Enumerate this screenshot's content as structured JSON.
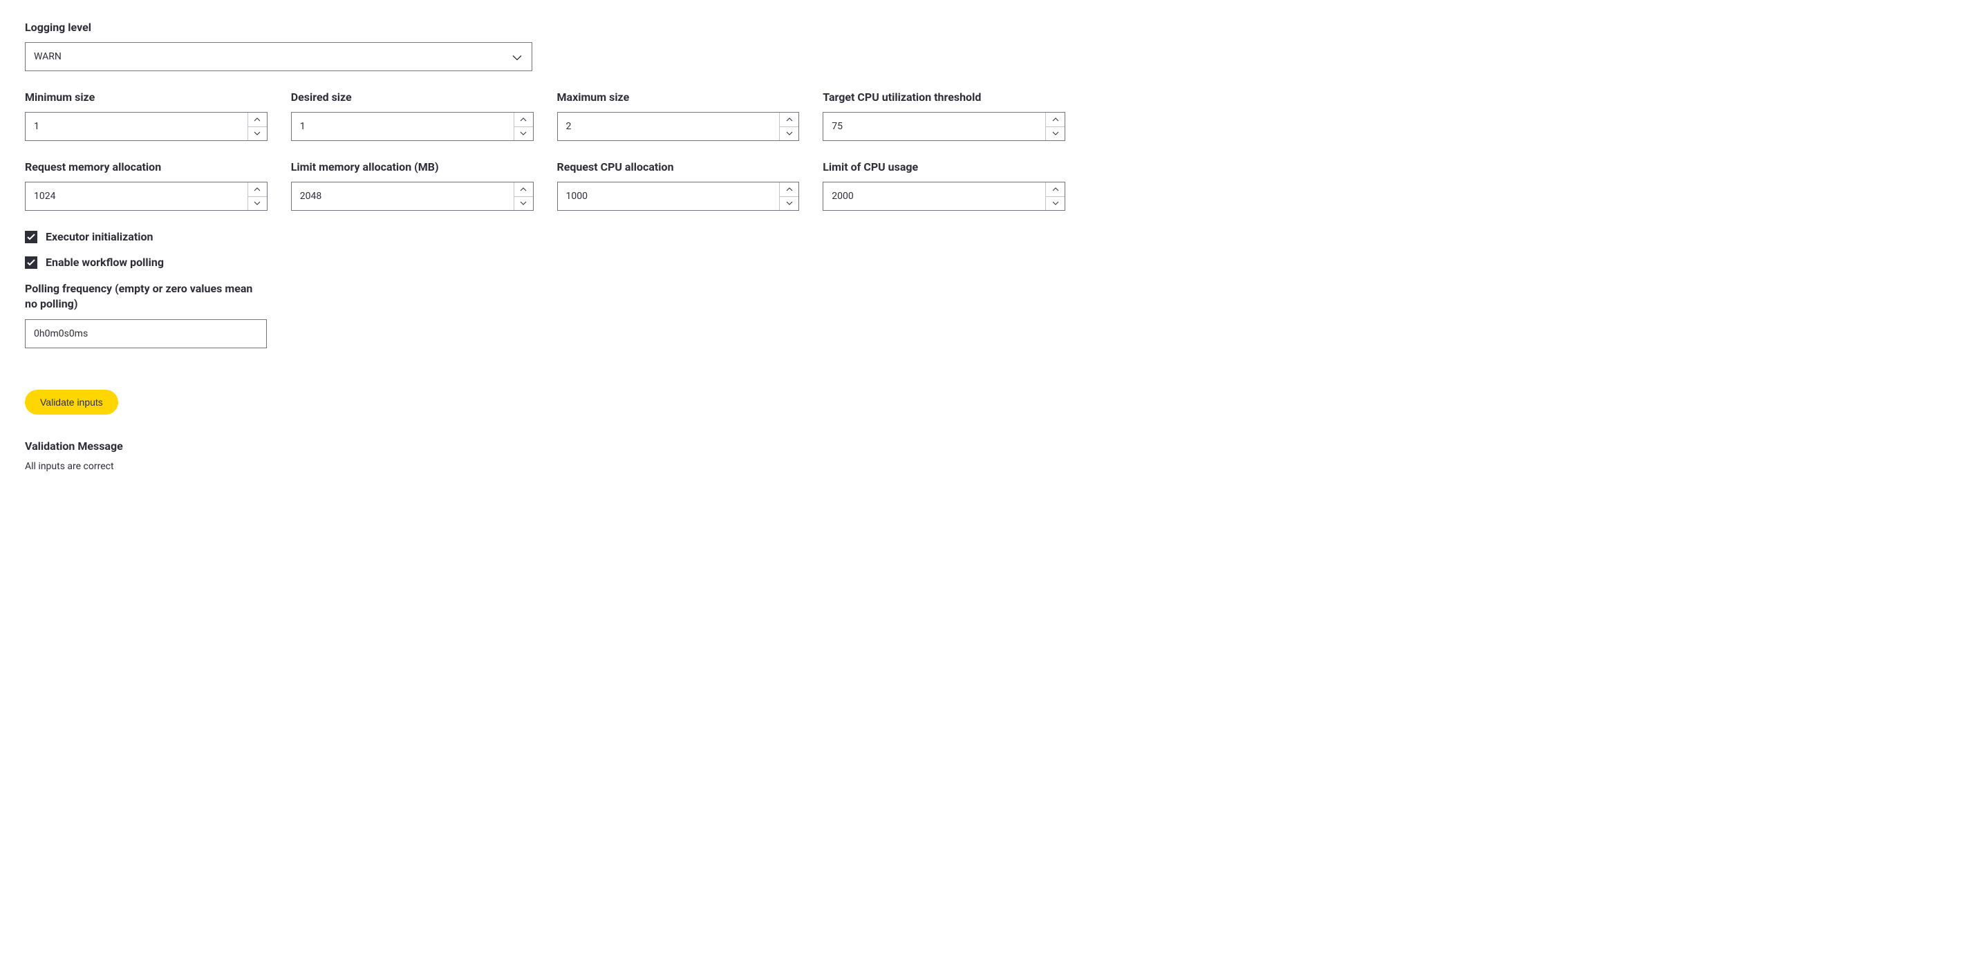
{
  "logging_level": {
    "label": "Logging level",
    "value": "WARN"
  },
  "sizes": {
    "minimum": {
      "label": "Minimum size",
      "value": "1"
    },
    "desired": {
      "label": "Desired size",
      "value": "1"
    },
    "maximum": {
      "label": "Maximum size",
      "value": "2"
    },
    "cpu_threshold": {
      "label": "Target CPU utilization threshold",
      "value": "75"
    }
  },
  "allocations": {
    "request_memory": {
      "label": "Request memory allocation",
      "value": "1024"
    },
    "limit_memory": {
      "label": "Limit memory allocation (MB)",
      "value": "2048"
    },
    "request_cpu": {
      "label": "Request CPU allocation",
      "value": "1000"
    },
    "limit_cpu": {
      "label": "Limit of CPU usage",
      "value": "2000"
    }
  },
  "checkboxes": {
    "executor_init": {
      "label": "Executor initialization",
      "checked": true
    },
    "workflow_polling": {
      "label": "Enable workflow polling",
      "checked": true
    }
  },
  "polling": {
    "label": "Polling frequency (empty or zero values mean no polling)",
    "value": "0h0m0s0ms"
  },
  "validate_button": "Validate inputs",
  "validation": {
    "heading": "Validation Message",
    "message": "All inputs are correct"
  }
}
